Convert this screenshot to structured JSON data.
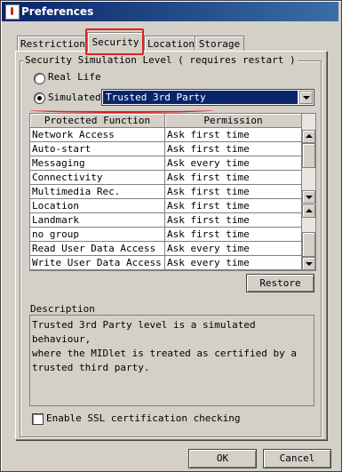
{
  "window": {
    "title": "Preferences"
  },
  "tabs": [
    {
      "label": "Restrictions"
    },
    {
      "label": "Security",
      "active": true
    },
    {
      "label": "Location"
    },
    {
      "label": "Storage"
    }
  ],
  "security": {
    "group_title": "Security Simulation Level ( requires restart )",
    "radio_real_life": {
      "label": "Real Life",
      "checked": false
    },
    "radio_simulated": {
      "label": "Simulated",
      "checked": true
    },
    "level_select": {
      "value": "Trusted 3rd Party"
    }
  },
  "table": {
    "headers": [
      "Protected Function",
      "Permission"
    ],
    "rows": [
      [
        "Network Access",
        "Ask first time"
      ],
      [
        "Auto-start",
        "Ask first time"
      ],
      [
        "Messaging",
        "Ask every time"
      ],
      [
        "Connectivity",
        "Ask first time"
      ],
      [
        "Multimedia Rec.",
        "Ask first time"
      ],
      [
        "Location",
        "Ask first time"
      ],
      [
        "Landmark",
        "Ask first time"
      ],
      [
        "no group",
        "Ask first time"
      ],
      [
        "Read User Data Access",
        "Ask every time"
      ],
      [
        "Write User Data Access",
        "Ask every time"
      ]
    ]
  },
  "restore_button": "Restore",
  "description": {
    "label": "Description",
    "text": "Trusted 3rd Party level is a simulated behaviour,\nwhere the MIDlet is treated as certified by a\ntrusted third party."
  },
  "ssl_checkbox": {
    "label": "Enable SSL certification checking",
    "checked": false
  },
  "buttons": {
    "ok": "OK",
    "cancel": "Cancel"
  },
  "colors": {
    "title_bar": "#0a246a",
    "selection": "#0a246a",
    "annotation_red": "#e02020"
  }
}
